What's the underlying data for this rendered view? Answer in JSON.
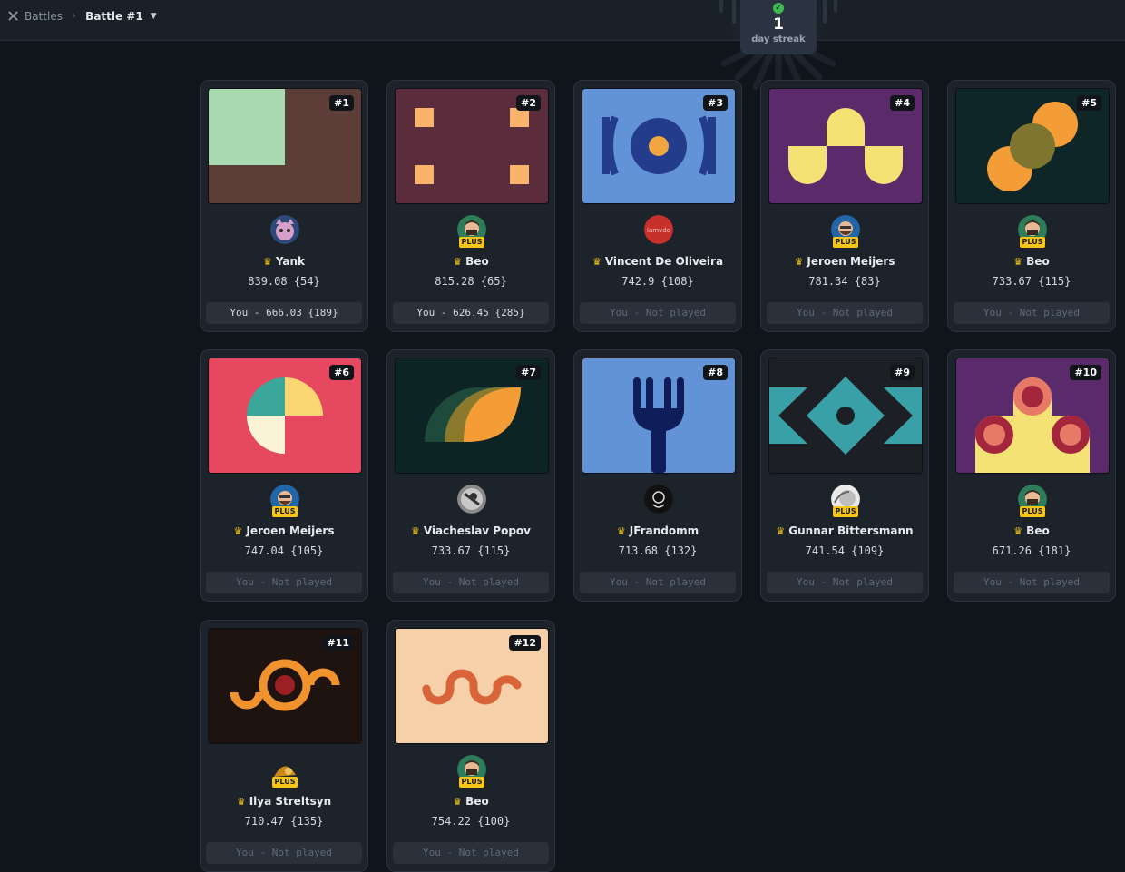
{
  "breadcrumb": {
    "root": "Battles",
    "current": "Battle #1"
  },
  "streak": {
    "count": "1",
    "label": "day streak"
  },
  "cards": [
    {
      "rank": "#1",
      "name": "Yank",
      "score": "839.08 {54}",
      "you": "You - 666.03 {189}",
      "plus": false
    },
    {
      "rank": "#2",
      "name": "Beo",
      "score": "815.28 {65}",
      "you": "You - 626.45 {285}",
      "plus": true
    },
    {
      "rank": "#3",
      "name": "Vincent De Oliveira",
      "score": "742.9 {108}",
      "you": "You - Not played",
      "plus": false
    },
    {
      "rank": "#4",
      "name": "Jeroen Meijers",
      "score": "781.34 {83}",
      "you": "You - Not played",
      "plus": true
    },
    {
      "rank": "#5",
      "name": "Beo",
      "score": "733.67 {115}",
      "you": "You - Not played",
      "plus": true
    },
    {
      "rank": "#6",
      "name": "Jeroen Meijers",
      "score": "747.04 {105}",
      "you": "You - Not played",
      "plus": true
    },
    {
      "rank": "#7",
      "name": "Viacheslav Popov",
      "score": "733.67 {115}",
      "you": "You - Not played",
      "plus": false
    },
    {
      "rank": "#8",
      "name": "JFrandomm",
      "score": "713.68 {132}",
      "you": "You - Not played",
      "plus": false
    },
    {
      "rank": "#9",
      "name": "Gunnar Bittersmann",
      "score": "741.54 {109}",
      "you": "You - Not played",
      "plus": true
    },
    {
      "rank": "#10",
      "name": "Beo",
      "score": "671.26 {181}",
      "you": "You - Not played",
      "plus": true
    },
    {
      "rank": "#11",
      "name": "Ilya Streltsyn",
      "score": "710.47 {135}",
      "you": "You - Not played",
      "plus": true
    },
    {
      "rank": "#12",
      "name": "Beo",
      "score": "754.22 {100}",
      "you": "You - Not played",
      "plus": true
    }
  ],
  "plus_label": "PLUS",
  "avatar_text_vdo": "iamvdo",
  "colors": {
    "background": "#10151b",
    "card": "#1d232b",
    "plus_badge": "#f5c518",
    "crown": "#f5c518",
    "streak_check": "#3fb950"
  }
}
